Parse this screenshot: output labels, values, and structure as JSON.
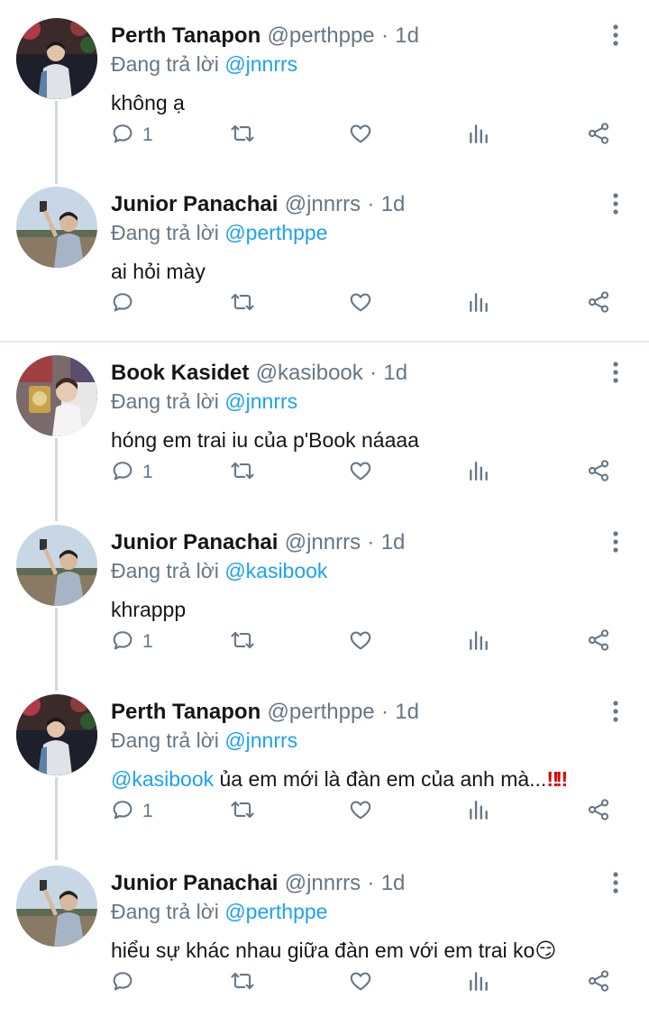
{
  "tweets": [
    {
      "name": "Perth Tanapon",
      "handle": "@perthppe",
      "dot": "·",
      "time": "1d",
      "replying_prefix": "Đang trả lời",
      "replying_to": "@jnnrrs",
      "text": "không ạ",
      "reply_count": "1",
      "avatar": "perth"
    },
    {
      "name": "Junior Panachai",
      "handle": "@jnnrrs",
      "dot": "·",
      "time": "1d",
      "replying_prefix": "Đang trả lời",
      "replying_to": "@perthppe",
      "text": "ai hỏi mày",
      "reply_count": "",
      "avatar": "junior"
    },
    {
      "name": "Book Kasidet",
      "handle": "@kasibook",
      "dot": "·",
      "time": "1d",
      "replying_prefix": "Đang trả lời",
      "replying_to": "@jnnrrs",
      "text": "hóng em trai iu của p'Book náaaa",
      "reply_count": "1",
      "avatar": "book"
    },
    {
      "name": "Junior Panachai",
      "handle": "@jnnrrs",
      "dot": "·",
      "time": "1d",
      "replying_prefix": "Đang trả lời",
      "replying_to": "@kasibook",
      "text": "khrappp",
      "reply_count": "1",
      "avatar": "junior"
    },
    {
      "name": "Perth Tanapon",
      "handle": "@perthppe",
      "dot": "·",
      "time": "1d",
      "replying_prefix": "Đang trả lời",
      "replying_to": "@jnnrrs",
      "text_mention": "@kasibook",
      "text": " ủa em mới là đàn em của anh mà...",
      "text_emoji": "‼",
      "reply_count": "1",
      "avatar": "perth"
    },
    {
      "name": "Junior Panachai",
      "handle": "@jnnrrs",
      "dot": "·",
      "time": "1d",
      "replying_prefix": "Đang trả lời",
      "replying_to": "@perthppe",
      "text": "hiểu sự khác nhau giữa đàn em với em trai ko",
      "text_emoji": "😏",
      "reply_count": "",
      "avatar": "junior"
    }
  ],
  "icons": {
    "reply": "reply-icon",
    "retweet": "retweet-icon",
    "like": "heart-icon",
    "stats": "stats-icon",
    "share": "share-icon",
    "more": "more-vertical-icon"
  },
  "colors": {
    "link": "#1da1f2",
    "secondary_text": "#657786",
    "primary_text": "#14171a",
    "thread_line": "#cfd9de"
  }
}
